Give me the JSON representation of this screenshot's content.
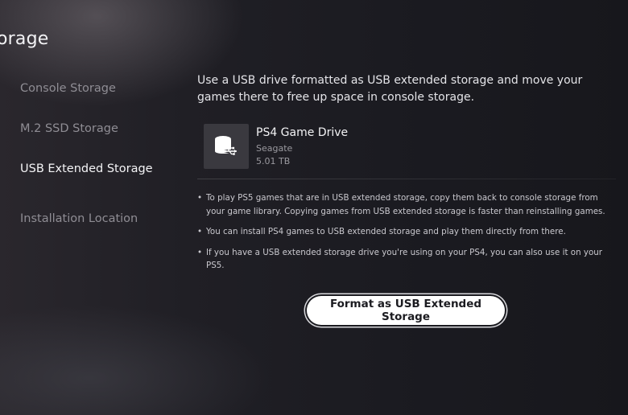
{
  "page": {
    "title": "orage"
  },
  "sidebar": {
    "items": [
      {
        "label": "Console Storage",
        "active": false
      },
      {
        "label": "M.2 SSD Storage",
        "active": false
      },
      {
        "label": "USB Extended Storage",
        "active": true
      },
      {
        "label": "Installation Location",
        "active": false
      }
    ]
  },
  "main": {
    "intro": "Use a USB drive formatted as USB extended storage and move your games there to free up space in console storage.",
    "drive": {
      "icon": "usb-drive-icon",
      "name": "PS4 Game Drive",
      "vendor": "Seagate",
      "size": "5.01 TB"
    },
    "bullet_glyph": "•",
    "bullets": [
      "To play PS5 games that are in USB extended storage, copy them back to console storage from your game library. Copying games from USB extended storage is faster than reinstalling games.",
      "You can install PS4 games to USB extended storage and play them directly from there.",
      "If you have a USB extended storage drive you're using on your PS4, you can also use it on your PS5."
    ],
    "format_button_label": "Format as USB Extended Storage"
  },
  "colors": {
    "background": "#1c1b21",
    "text_primary": "#f2f2f4",
    "text_inactive": "#8f8d94",
    "button_bg": "#ffffff",
    "button_text": "#1b1b20"
  }
}
